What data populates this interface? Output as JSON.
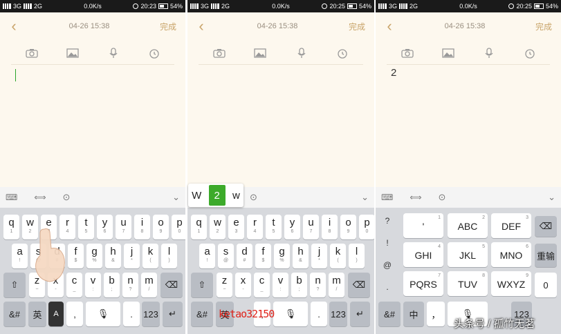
{
  "screens": [
    {
      "status": {
        "network": "3G",
        "network2": "2G",
        "speed": "0.0K/s",
        "time": "20:23",
        "battery": "54%"
      },
      "header": {
        "date": "04-26 15:38",
        "done": "完成"
      },
      "note_text": ""
    },
    {
      "status": {
        "network": "3G",
        "network2": "2G",
        "speed": "0.0K/s",
        "time": "20:25",
        "battery": "54%"
      },
      "header": {
        "date": "04-26 15:38",
        "done": "完成"
      },
      "note_text": "",
      "popup": {
        "left": "W",
        "selected": "2",
        "right": "w"
      }
    },
    {
      "status": {
        "network": "3G",
        "network2": "2G",
        "speed": "0.0K/s",
        "time": "20:25",
        "battery": "54%"
      },
      "header": {
        "date": "04-26 15:38",
        "done": "完成"
      },
      "note_text": "2"
    }
  ],
  "qwerty": {
    "row1": [
      [
        "q",
        "1"
      ],
      [
        "w",
        "2"
      ],
      [
        "e",
        "3"
      ],
      [
        "r",
        "4"
      ],
      [
        "t",
        "5"
      ],
      [
        "y",
        "6"
      ],
      [
        "u",
        "7"
      ],
      [
        "i",
        "8"
      ],
      [
        "o",
        "9"
      ],
      [
        "p",
        "0"
      ]
    ],
    "row2": [
      [
        "a",
        "!"
      ],
      [
        "s",
        "@"
      ],
      [
        "d",
        "#"
      ],
      [
        "f",
        "$"
      ],
      [
        "g",
        "%"
      ],
      [
        "h",
        "&"
      ],
      [
        "j",
        "*"
      ],
      [
        "k",
        "("
      ],
      [
        "l",
        ")"
      ]
    ],
    "row3": [
      [
        "z",
        "~"
      ],
      [
        "x",
        "-"
      ],
      [
        "c",
        "_"
      ],
      [
        "v",
        ":"
      ],
      [
        "b",
        ";"
      ],
      [
        "n",
        "?"
      ],
      [
        "m",
        "/"
      ]
    ],
    "sym": "&#",
    "lang": "英",
    "comma": ",",
    "period": ".",
    "num": "123"
  },
  "t9": {
    "side": [
      "?",
      "!",
      "@",
      "."
    ],
    "keys": [
      [
        "'",
        "1"
      ],
      [
        "ABC",
        "2"
      ],
      [
        "DEF",
        "3"
      ],
      [
        "GHI",
        "4"
      ],
      [
        "JKL",
        "5"
      ],
      [
        "MNO",
        "6"
      ],
      [
        "PQRS",
        "7"
      ],
      [
        "TUV",
        "8"
      ],
      [
        "WXYZ",
        "9"
      ]
    ],
    "redo": "重输",
    "zero": "0",
    "sym": "&#",
    "lang": "中",
    "comma": "，",
    "num": "123"
  },
  "watermarks": {
    "red": "ketao32150",
    "corner": "头条号 / 孤竹无茗"
  },
  "colors": {
    "accent": "#c9a46a",
    "popup_selected": "#3caa2a"
  },
  "icons": [
    "chevron-left-icon",
    "camera-icon",
    "image-icon",
    "microphone-icon",
    "alarm-icon",
    "keyboard-icon",
    "text-cursor-icon",
    "more-icon",
    "chevron-down-icon",
    "shift-icon",
    "backspace-icon",
    "enter-icon",
    "mic-icon"
  ]
}
